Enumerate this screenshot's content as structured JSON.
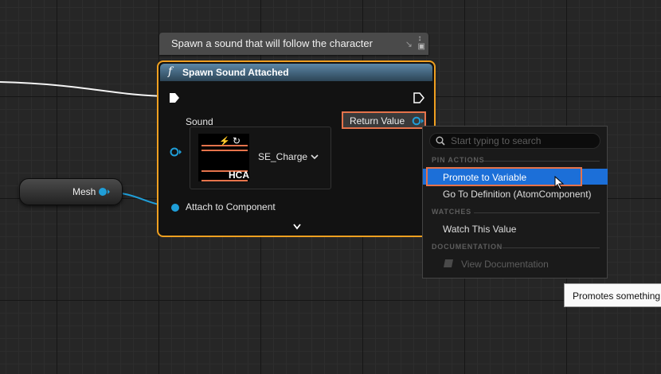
{
  "comment": {
    "text": "Spawn a sound that will follow the character"
  },
  "node": {
    "title": "Spawn Sound Attached",
    "function_icon": "f",
    "pins": {
      "sound_label": "Sound",
      "attach_label": "Attach to Component",
      "return_label": "Return Value"
    },
    "asset": {
      "name": "SE_Charge",
      "thumbnail_text": "HCA"
    }
  },
  "mesh_node": {
    "label": "Mesh"
  },
  "context_menu": {
    "search_placeholder": "Start typing to search",
    "sections": {
      "pin_actions": "PIN ACTIONS",
      "watches": "WATCHES",
      "documentation": "DOCUMENTATION"
    },
    "items": {
      "promote": "Promote to Variable",
      "goto_definition": "Go To Definition (AtomComponent)",
      "watch": "Watch This Value",
      "view_docs": "View Documentation"
    }
  },
  "tooltip": {
    "text": "Promotes something"
  },
  "colors": {
    "node_border": "#f0a020",
    "highlight": "#e5734b",
    "selection": "#1c6fd8",
    "pin_blue": "#1f9ed8"
  }
}
